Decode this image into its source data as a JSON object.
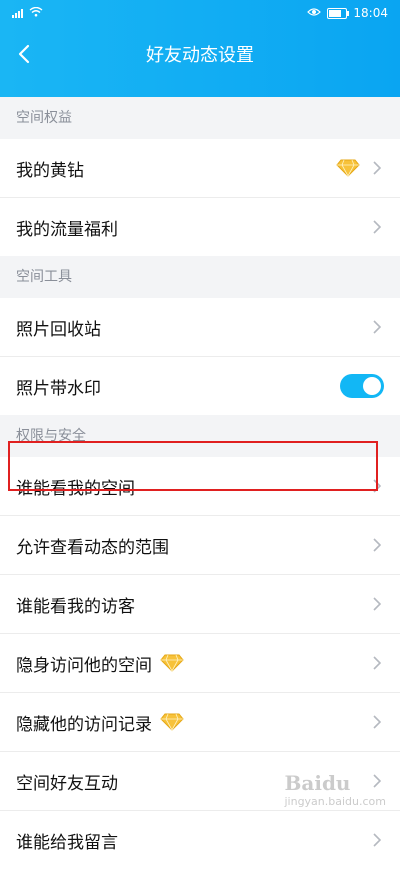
{
  "status_bar": {
    "time": "18:04",
    "icons": [
      "signal-icon",
      "wifi-icon",
      "eye-icon",
      "battery-icon"
    ]
  },
  "header": {
    "title": "好友动态设置",
    "back_icon": "chevron-left-icon",
    "background": "#12b7f5"
  },
  "sections": [
    {
      "title": "空间权益",
      "items": [
        {
          "label": "我的黄钻",
          "right_icon": "diamond-icon"
        },
        {
          "label": "我的流量福利"
        }
      ]
    },
    {
      "title": "空间工具",
      "items": [
        {
          "label": "照片回收站"
        },
        {
          "label": "照片带水印",
          "toggle_on": true
        }
      ]
    },
    {
      "title": "权限与安全",
      "items": [
        {
          "label": "谁能看我的空间",
          "highlighted": true
        },
        {
          "label": "允许查看动态的范围"
        },
        {
          "label": "谁能看我的访客"
        },
        {
          "label": "隐身访问他的空间",
          "inline_icon": "diamond-icon"
        },
        {
          "label": "隐藏他的访问记录",
          "inline_icon": "diamond-icon"
        },
        {
          "label": "空间好友互动"
        },
        {
          "label": "谁能给我留言"
        }
      ]
    }
  ],
  "watermark": {
    "text": "Baidu",
    "sub": "jingyan.baidu.com"
  },
  "colors": {
    "accent": "#12b7f5",
    "highlight_border": "#e02020",
    "diamond": "#f7c23a"
  }
}
